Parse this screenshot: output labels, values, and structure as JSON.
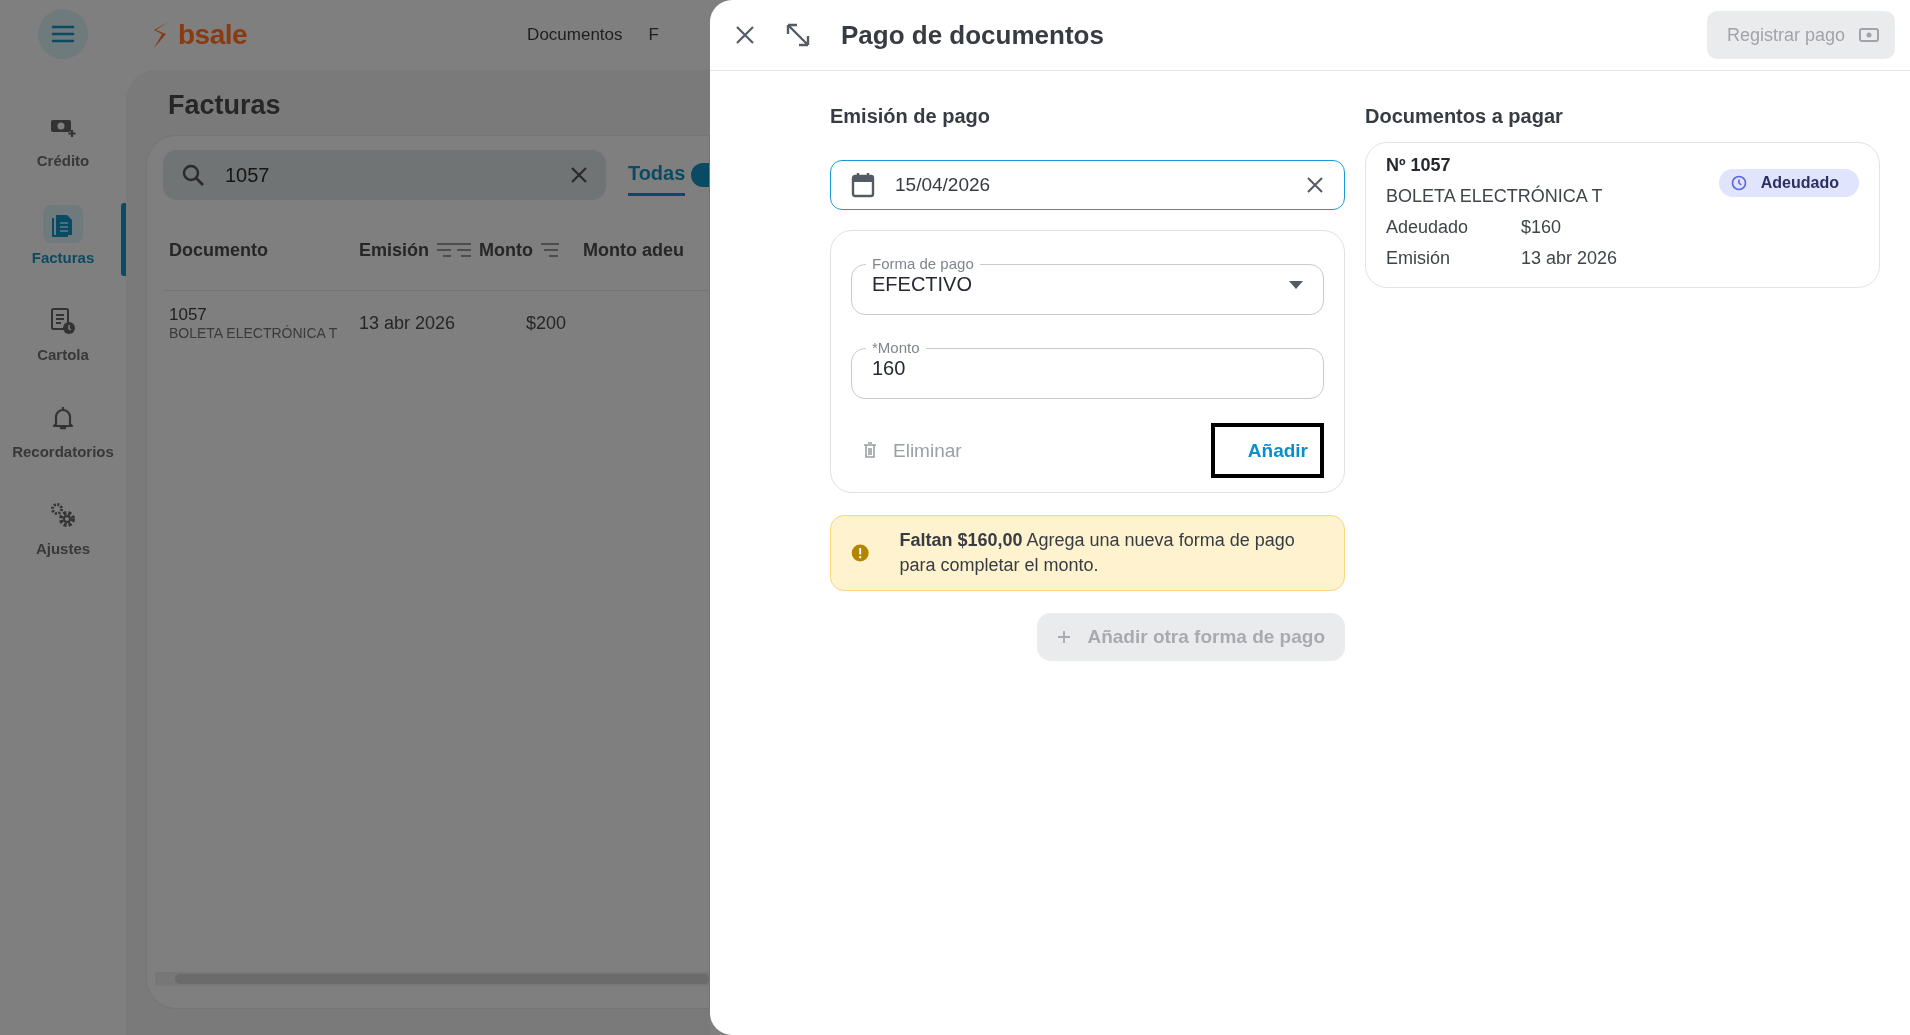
{
  "app": {
    "logo": "bsale",
    "top_nav": [
      "Documentos",
      "F"
    ],
    "sidebar": {
      "items": [
        {
          "label": "Crédito",
          "selected": false
        },
        {
          "label": "Facturas",
          "selected": true
        },
        {
          "label": "Cartola",
          "selected": false
        },
        {
          "label": "Recordatorios",
          "selected": false
        },
        {
          "label": "Ajustes",
          "selected": false
        }
      ]
    },
    "page_title": "Facturas",
    "search": {
      "value": "1057"
    },
    "tabs": [
      {
        "label": "Todas",
        "selected": true
      }
    ],
    "table": {
      "columns": [
        {
          "label": "Documento"
        },
        {
          "label": "Emisión"
        },
        {
          "label": "Monto"
        },
        {
          "label": "Monto adeu"
        }
      ],
      "rows": [
        {
          "number": "1057",
          "type": "BOLETA ELECTRÓNICA T",
          "emission": "13 abr 2026",
          "amount": "$200"
        }
      ]
    }
  },
  "drawer": {
    "title": "Pago de documentos",
    "register_button": {
      "label": "Registrar pago",
      "disabled": true
    },
    "payment": {
      "heading": "Emisión de pago",
      "date_field": {
        "value": "15/04/2026",
        "focused": true
      },
      "method_select": {
        "label": "Forma de pago",
        "value": "EFECTIVO"
      },
      "amount_field": {
        "label": "*Monto",
        "value": "160"
      },
      "delete_button": "Eliminar",
      "add_button": {
        "label": "Añadir",
        "focused": true
      },
      "alert": "**Faltan $160,00** Agrega una nueva forma de pago para completar el monto.",
      "add_method_button": {
        "label": "Añadir otra forma de pago",
        "disabled": true
      }
    },
    "documents": {
      "heading": "Documentos a pagar",
      "cards": [
        {
          "number": "Nº 1057",
          "type": "BOLETA ELECTRÓNICA T",
          "status": "Adeudado",
          "fields": [
            {
              "label": "Adeudado",
              "value": "$160"
            },
            {
              "label": "Emisión",
              "value": "13 abr 2026"
            }
          ]
        }
      ]
    }
  }
}
